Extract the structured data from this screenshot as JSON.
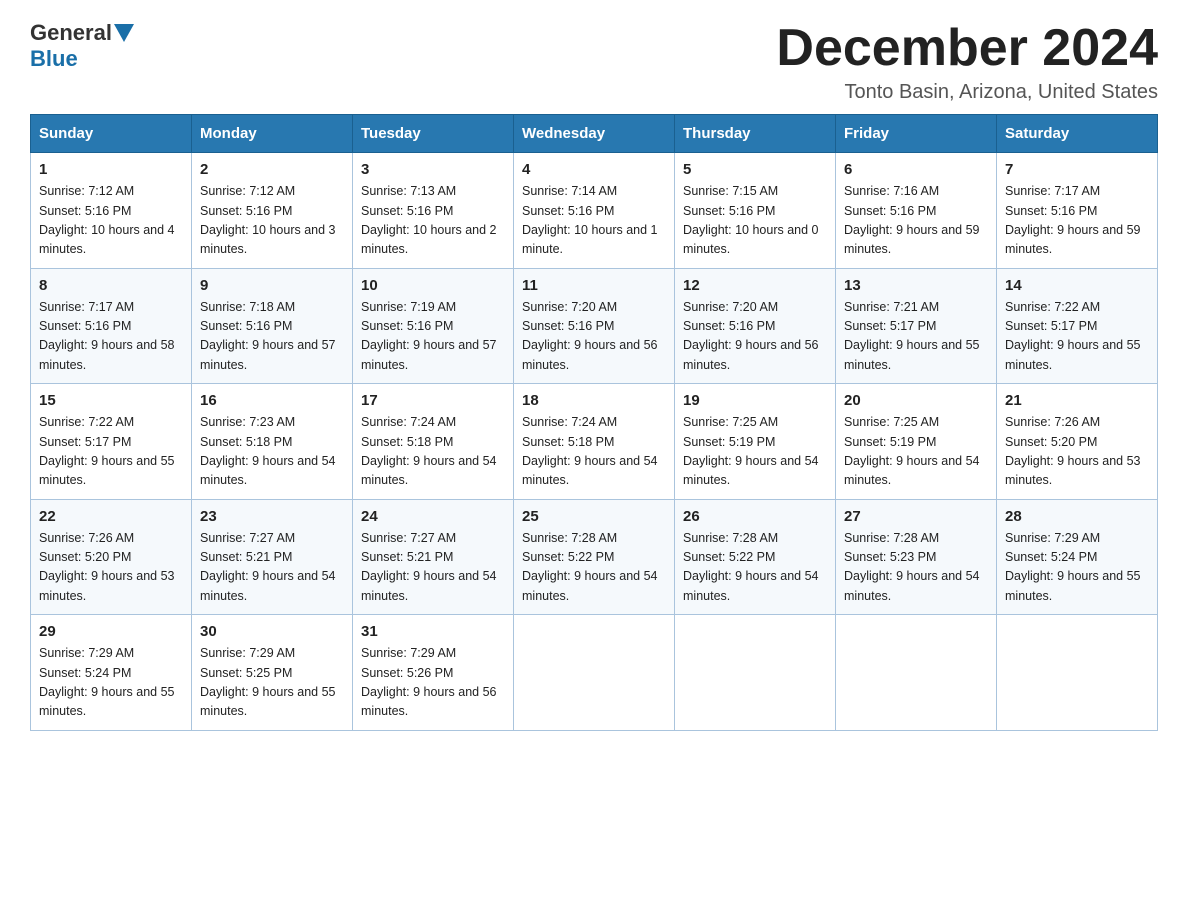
{
  "header": {
    "logo_general": "General",
    "logo_blue": "Blue",
    "month_title": "December 2024",
    "location": "Tonto Basin, Arizona, United States"
  },
  "days_of_week": [
    "Sunday",
    "Monday",
    "Tuesday",
    "Wednesday",
    "Thursday",
    "Friday",
    "Saturday"
  ],
  "weeks": [
    [
      {
        "day": "1",
        "sunrise": "7:12 AM",
        "sunset": "5:16 PM",
        "daylight": "10 hours and 4 minutes."
      },
      {
        "day": "2",
        "sunrise": "7:12 AM",
        "sunset": "5:16 PM",
        "daylight": "10 hours and 3 minutes."
      },
      {
        "day": "3",
        "sunrise": "7:13 AM",
        "sunset": "5:16 PM",
        "daylight": "10 hours and 2 minutes."
      },
      {
        "day": "4",
        "sunrise": "7:14 AM",
        "sunset": "5:16 PM",
        "daylight": "10 hours and 1 minute."
      },
      {
        "day": "5",
        "sunrise": "7:15 AM",
        "sunset": "5:16 PM",
        "daylight": "10 hours and 0 minutes."
      },
      {
        "day": "6",
        "sunrise": "7:16 AM",
        "sunset": "5:16 PM",
        "daylight": "9 hours and 59 minutes."
      },
      {
        "day": "7",
        "sunrise": "7:17 AM",
        "sunset": "5:16 PM",
        "daylight": "9 hours and 59 minutes."
      }
    ],
    [
      {
        "day": "8",
        "sunrise": "7:17 AM",
        "sunset": "5:16 PM",
        "daylight": "9 hours and 58 minutes."
      },
      {
        "day": "9",
        "sunrise": "7:18 AM",
        "sunset": "5:16 PM",
        "daylight": "9 hours and 57 minutes."
      },
      {
        "day": "10",
        "sunrise": "7:19 AM",
        "sunset": "5:16 PM",
        "daylight": "9 hours and 57 minutes."
      },
      {
        "day": "11",
        "sunrise": "7:20 AM",
        "sunset": "5:16 PM",
        "daylight": "9 hours and 56 minutes."
      },
      {
        "day": "12",
        "sunrise": "7:20 AM",
        "sunset": "5:16 PM",
        "daylight": "9 hours and 56 minutes."
      },
      {
        "day": "13",
        "sunrise": "7:21 AM",
        "sunset": "5:17 PM",
        "daylight": "9 hours and 55 minutes."
      },
      {
        "day": "14",
        "sunrise": "7:22 AM",
        "sunset": "5:17 PM",
        "daylight": "9 hours and 55 minutes."
      }
    ],
    [
      {
        "day": "15",
        "sunrise": "7:22 AM",
        "sunset": "5:17 PM",
        "daylight": "9 hours and 55 minutes."
      },
      {
        "day": "16",
        "sunrise": "7:23 AM",
        "sunset": "5:18 PM",
        "daylight": "9 hours and 54 minutes."
      },
      {
        "day": "17",
        "sunrise": "7:24 AM",
        "sunset": "5:18 PM",
        "daylight": "9 hours and 54 minutes."
      },
      {
        "day": "18",
        "sunrise": "7:24 AM",
        "sunset": "5:18 PM",
        "daylight": "9 hours and 54 minutes."
      },
      {
        "day": "19",
        "sunrise": "7:25 AM",
        "sunset": "5:19 PM",
        "daylight": "9 hours and 54 minutes."
      },
      {
        "day": "20",
        "sunrise": "7:25 AM",
        "sunset": "5:19 PM",
        "daylight": "9 hours and 54 minutes."
      },
      {
        "day": "21",
        "sunrise": "7:26 AM",
        "sunset": "5:20 PM",
        "daylight": "9 hours and 53 minutes."
      }
    ],
    [
      {
        "day": "22",
        "sunrise": "7:26 AM",
        "sunset": "5:20 PM",
        "daylight": "9 hours and 53 minutes."
      },
      {
        "day": "23",
        "sunrise": "7:27 AM",
        "sunset": "5:21 PM",
        "daylight": "9 hours and 54 minutes."
      },
      {
        "day": "24",
        "sunrise": "7:27 AM",
        "sunset": "5:21 PM",
        "daylight": "9 hours and 54 minutes."
      },
      {
        "day": "25",
        "sunrise": "7:28 AM",
        "sunset": "5:22 PM",
        "daylight": "9 hours and 54 minutes."
      },
      {
        "day": "26",
        "sunrise": "7:28 AM",
        "sunset": "5:22 PM",
        "daylight": "9 hours and 54 minutes."
      },
      {
        "day": "27",
        "sunrise": "7:28 AM",
        "sunset": "5:23 PM",
        "daylight": "9 hours and 54 minutes."
      },
      {
        "day": "28",
        "sunrise": "7:29 AM",
        "sunset": "5:24 PM",
        "daylight": "9 hours and 55 minutes."
      }
    ],
    [
      {
        "day": "29",
        "sunrise": "7:29 AM",
        "sunset": "5:24 PM",
        "daylight": "9 hours and 55 minutes."
      },
      {
        "day": "30",
        "sunrise": "7:29 AM",
        "sunset": "5:25 PM",
        "daylight": "9 hours and 55 minutes."
      },
      {
        "day": "31",
        "sunrise": "7:29 AM",
        "sunset": "5:26 PM",
        "daylight": "9 hours and 56 minutes."
      },
      null,
      null,
      null,
      null
    ]
  ]
}
